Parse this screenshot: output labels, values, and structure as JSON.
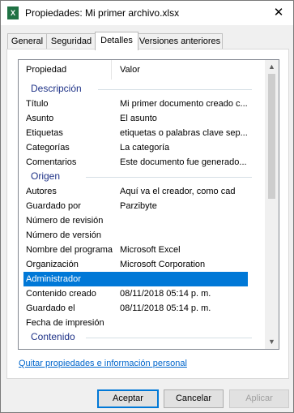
{
  "window": {
    "title": "Propiedades: Mi primer archivo.xlsx",
    "close_glyph": "✕",
    "icon_text": "X"
  },
  "tabs": [
    {
      "label": "General"
    },
    {
      "label": "Seguridad"
    },
    {
      "label": "Detalles"
    },
    {
      "label": "Versiones anteriores"
    }
  ],
  "details": {
    "col_property": "Propiedad",
    "col_value": "Valor",
    "groups": [
      {
        "label": "Descripción",
        "rows": [
          {
            "property": "Título",
            "value": "Mi primer documento creado c..."
          },
          {
            "property": "Asunto",
            "value": "El asunto"
          },
          {
            "property": "Etiquetas",
            "value": "etiquetas o palabras clave sep..."
          },
          {
            "property": "Categorías",
            "value": "La categoría"
          },
          {
            "property": "Comentarios",
            "value": "Este documento fue generado..."
          }
        ]
      },
      {
        "label": "Origen",
        "rows": [
          {
            "property": "Autores",
            "value": "Aquí va el creador, como cad"
          },
          {
            "property": "Guardado por",
            "value": "Parzibyte"
          },
          {
            "property": "Número de revisión",
            "value": ""
          },
          {
            "property": "Número de versión",
            "value": ""
          },
          {
            "property": "Nombre del programa",
            "value": "Microsoft Excel"
          },
          {
            "property": "Organización",
            "value": "Microsoft Corporation"
          },
          {
            "property": "Administrador",
            "value": ""
          },
          {
            "property": "Contenido creado",
            "value": "08/11/2018 05:14 p. m."
          },
          {
            "property": "Guardado el",
            "value": "08/11/2018 05:14 p. m."
          },
          {
            "property": "Fecha de impresión",
            "value": ""
          }
        ]
      },
      {
        "label": "Contenido",
        "rows": []
      }
    ]
  },
  "link_text": "Quitar propiedades e información personal",
  "buttons": {
    "ok": "Aceptar",
    "cancel": "Cancelar",
    "apply": "Aplicar"
  },
  "colors": {
    "selection": "#0078d7",
    "group_header": "#1e3287",
    "link": "#0066cc"
  }
}
